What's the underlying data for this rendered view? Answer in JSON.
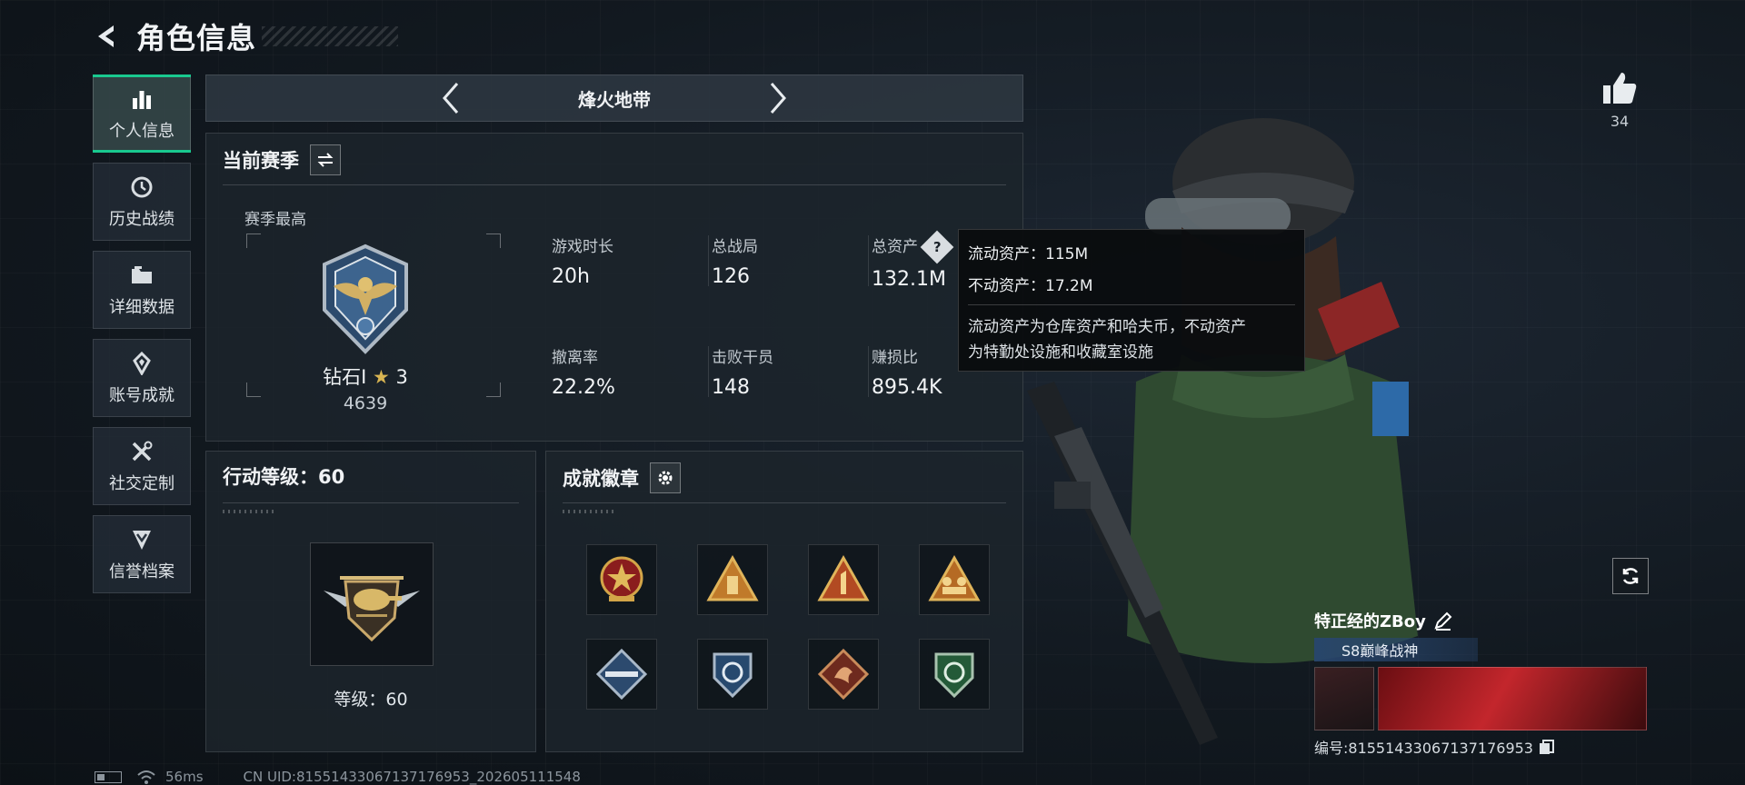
{
  "header": {
    "title": "角色信息"
  },
  "sidebar": {
    "items": [
      {
        "label": "个人信息",
        "icon": "bar-chart-icon",
        "active": true
      },
      {
        "label": "历史战绩",
        "icon": "history-icon"
      },
      {
        "label": "详细数据",
        "icon": "folder-icon"
      },
      {
        "label": "账号成就",
        "icon": "achievement-icon"
      },
      {
        "label": "社交定制",
        "icon": "tools-icon"
      },
      {
        "label": "信誉档案",
        "icon": "shield-chevron-icon"
      }
    ]
  },
  "mode": {
    "title": "烽火地带"
  },
  "season": {
    "title": "当前赛季",
    "best_label": "赛季最高",
    "rank_name": "钻石I",
    "rank_star": "★",
    "rank_stars": "3",
    "rank_score": "4639",
    "stats": [
      {
        "label": "游戏时长",
        "value": "20h"
      },
      {
        "label": "总战局",
        "value": "126"
      },
      {
        "label": "总资产",
        "value": "132.1M"
      },
      {
        "label": "撤离率",
        "value": "22.2%"
      },
      {
        "label": "击败干员",
        "value": "148"
      },
      {
        "label": "赚损比",
        "value": "895.4K"
      }
    ]
  },
  "tooltip": {
    "liquid": "流动资产：115M",
    "fixed": "不动资产：17.2M",
    "desc_line1": "流动资产为仓库资产和哈夫币，不动资产",
    "desc_line2": "为特勤处设施和收藏室设施"
  },
  "level": {
    "title": "行动等级：60",
    "label": "等级：60"
  },
  "badges": {
    "title": "成就徽章",
    "items": [
      "red-star-medal-icon",
      "gold-triangle-icon",
      "number-one-triangle-icon",
      "squad-triangle-icon",
      "blue-diamond-rifle-icon",
      "blue-shield-icon",
      "dragon-diamond-icon",
      "green-shield-icon"
    ]
  },
  "profile": {
    "likes": "34",
    "player_name": "特正经的ZBoy",
    "title_tag": "S8巅峰战神",
    "id_text": "编号:81551433067137176953"
  },
  "footer": {
    "ping": "56ms",
    "uid": "CN UID:81551433067137176953_202605111548"
  },
  "colors": {
    "accent": "#19c98f",
    "gold": "#d8b452"
  }
}
